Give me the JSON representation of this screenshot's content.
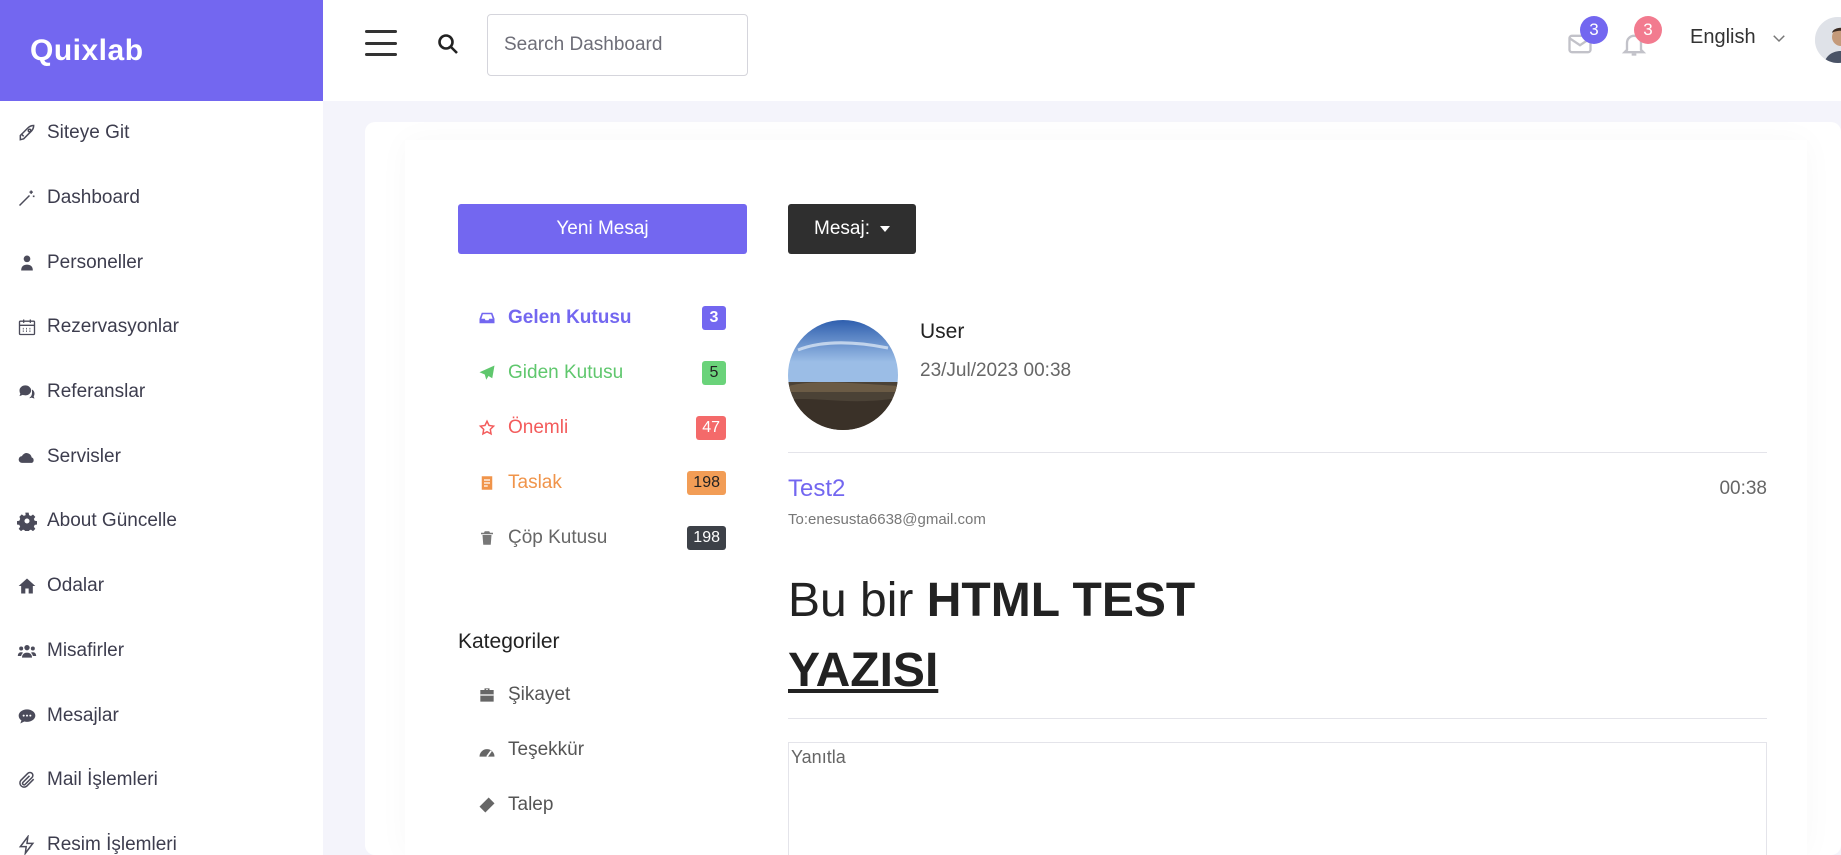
{
  "brand": {
    "name": "Quixlab"
  },
  "sidebar": {
    "items": [
      {
        "label": "Siteye Git",
        "icon": "rocket-icon"
      },
      {
        "label": "Dashboard",
        "icon": "magic-wand-icon"
      },
      {
        "label": "Personeller",
        "icon": "user-icon"
      },
      {
        "label": "Rezervasyonlar",
        "icon": "calendar-icon"
      },
      {
        "label": "Referanslar",
        "icon": "comments-icon"
      },
      {
        "label": "Servisler",
        "icon": "cloud-icon"
      },
      {
        "label": "About Güncelle",
        "icon": "gear-icon"
      },
      {
        "label": "Odalar",
        "icon": "home-icon"
      },
      {
        "label": "Misafirler",
        "icon": "users-icon"
      },
      {
        "label": "Mesajlar",
        "icon": "chat-icon"
      },
      {
        "label": "Mail İşlemleri",
        "icon": "paperclip-icon"
      },
      {
        "label": "Resim İşlemleri",
        "icon": "bolt-icon"
      }
    ]
  },
  "topbar": {
    "search_placeholder": "Search Dashboard",
    "mail_badge": "3",
    "notification_badge": "3",
    "language": "English"
  },
  "actions": {
    "new_message": "Yeni Mesaj",
    "message_dropdown": "Mesaj:"
  },
  "folders": [
    {
      "label": "Gelen Kutusu",
      "count": "3",
      "color": "#7367f0",
      "badge": "#7367f0",
      "icon": "inbox-icon"
    },
    {
      "label": "Giden Kutusu",
      "count": "5",
      "color": "#5fc76d",
      "badge": "#6ad37a",
      "icon": "paper-plane-icon"
    },
    {
      "label": "Önemli",
      "count": "47",
      "color": "#f35b5b",
      "badge": "#f46a6a",
      "icon": "star-icon"
    },
    {
      "label": "Taslak",
      "count": "198",
      "color": "#f0944a",
      "badge": "#f29d56",
      "icon": "draft-icon"
    },
    {
      "label": "Çöp Kutusu",
      "count": "198",
      "color": "#666666",
      "badge": "#3d4148",
      "icon": "trash-icon"
    }
  ],
  "categories": {
    "title": "Kategoriler",
    "items": [
      {
        "label": "Şikayet",
        "icon": "briefcase-icon"
      },
      {
        "label": "Teşekkür",
        "icon": "chart-icon"
      },
      {
        "label": "Talep",
        "icon": "ticket-icon"
      }
    ]
  },
  "message": {
    "sender": "User",
    "date": "23/Jul/2023 00:38",
    "subject": "Test2",
    "time": "00:38",
    "to": "To:enesusta6638@gmail.com",
    "body_plain": "Bu bir ",
    "body_bold": "HTML TEST",
    "body_underline": "YAZISI",
    "reply_placeholder": "Yanıtla"
  }
}
